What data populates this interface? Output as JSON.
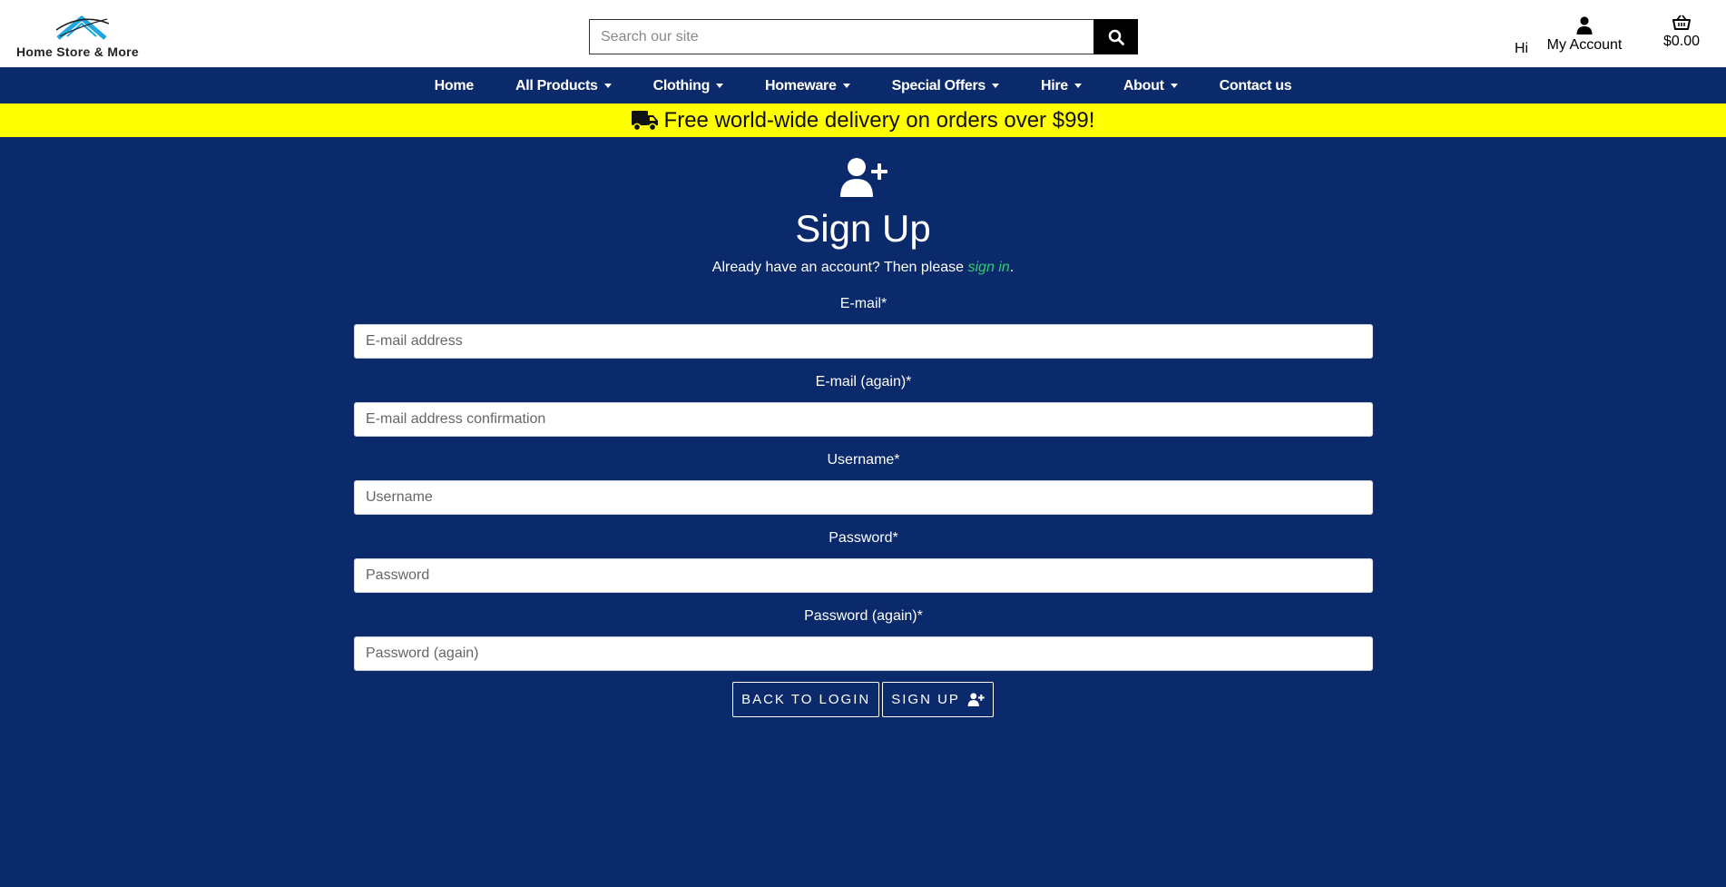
{
  "brand": {
    "name": "Home Store & More"
  },
  "search": {
    "placeholder": "Search our site"
  },
  "header": {
    "greeting": "Hi",
    "account_label": "My Account",
    "cart_total": "$0.00"
  },
  "nav": {
    "items": [
      {
        "label": "Home",
        "dropdown": false
      },
      {
        "label": "All Products",
        "dropdown": true
      },
      {
        "label": "Clothing",
        "dropdown": true
      },
      {
        "label": "Homeware",
        "dropdown": true
      },
      {
        "label": "Special Offers",
        "dropdown": true
      },
      {
        "label": "Hire",
        "dropdown": true
      },
      {
        "label": "About",
        "dropdown": true
      },
      {
        "label": "Contact us",
        "dropdown": false
      }
    ]
  },
  "banner": {
    "text": "Free world-wide delivery on orders over $99!"
  },
  "page": {
    "title": "Sign Up",
    "already_prefix": "Already have an account? Then please ",
    "already_link": "sign in",
    "already_suffix": "."
  },
  "form": {
    "fields": [
      {
        "label": "E-mail*",
        "placeholder": "E-mail address",
        "value": ""
      },
      {
        "label": "E-mail (again)*",
        "placeholder": "E-mail address confirmation",
        "value": ""
      },
      {
        "label": "Username*",
        "placeholder": "Username",
        "value": ""
      },
      {
        "label": "Password*",
        "placeholder": "Password",
        "value": ""
      },
      {
        "label": "Password (again)*",
        "placeholder": "Password (again)",
        "value": ""
      }
    ],
    "back_label": "BACK TO LOGIN",
    "submit_label": "SIGN UP"
  },
  "colors": {
    "nav_bg": "#0b2a6b",
    "banner_bg": "#ffff00",
    "link": "#2ecc71",
    "header_bg": "#ffffff"
  },
  "icons": {
    "logo": "roof-logo-icon",
    "search": "search-icon",
    "account": "user-icon",
    "cart": "basket-icon",
    "banner": "truck-icon",
    "signup": "user-plus-icon"
  }
}
